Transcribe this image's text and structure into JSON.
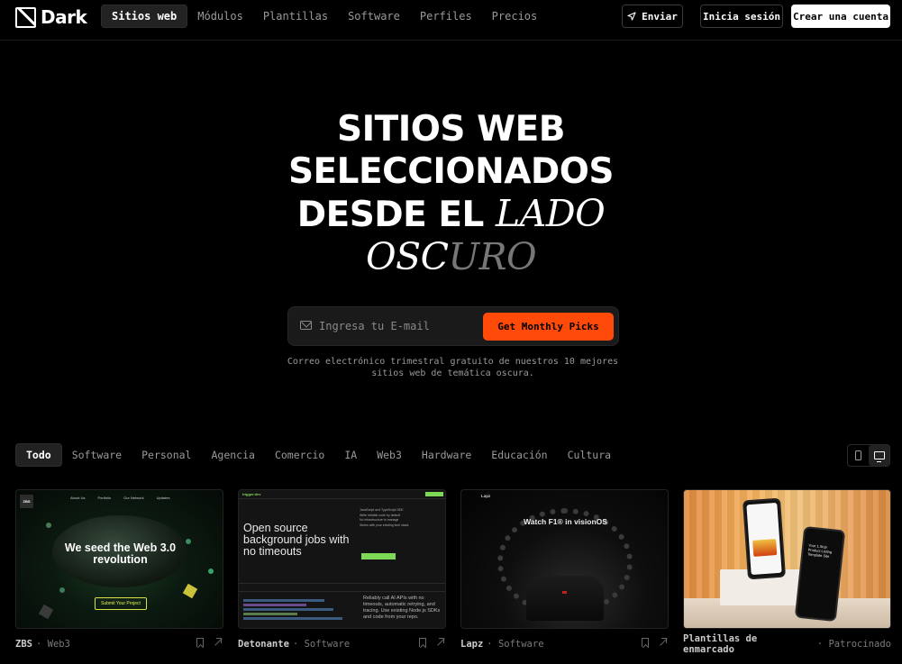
{
  "brand": {
    "name": "Dark"
  },
  "nav": {
    "links": [
      "Sitios web",
      "Módulos",
      "Plantillas",
      "Software",
      "Perfiles",
      "Precios"
    ],
    "submit_label": "Enviar",
    "login_label": "Inicia sesión",
    "signup_label": "Crear una cuenta"
  },
  "hero": {
    "line1": "SITIOS WEB",
    "line2": "SELECCIONADOS",
    "line3": "DESDE EL",
    "line3_serif": "LADO",
    "line4_a": "OSC",
    "line4_b": "URO",
    "email_placeholder": "Ingresa tu E-mail",
    "cta_label": "Get Monthly Picks",
    "note": "Correo electrónico trimestral gratuito de nuestros 10 mejores sitios web de temática oscura."
  },
  "filters": [
    "Todo",
    "Software",
    "Personal",
    "Agencia",
    "Comercio",
    "IA",
    "Web3",
    "Hardware",
    "Educación",
    "Cultura"
  ],
  "view_modes": [
    "mobile",
    "desktop"
  ],
  "cards": [
    {
      "name": "ZBS",
      "category": "Web3",
      "preview": {
        "badge": "ZBS",
        "nav": [
          "About Us",
          "Portfolio",
          "Our Network",
          "Updates"
        ],
        "headline_1": "We seed the Web 3.0",
        "headline_2": "revolution",
        "cta": "Submit Your Project"
      }
    },
    {
      "name": "Detonante",
      "category": "Software",
      "preview": {
        "logo": "trigger.dev",
        "headline": "Open source background jobs with no timeouts",
        "bullets": [
          "JavaScript and TypeScript SDK",
          "Write reliable code by default",
          "No infrastructure to manage",
          "Works with your existing tech stack"
        ],
        "description": "Reliably call AI APIs with no timeouts, automatic retrying, and tracing. Use existing Node.js SDKs and code from your repo."
      }
    },
    {
      "name": "Lapz",
      "category": "Software",
      "preview": {
        "logo": "Lapz",
        "title": "Watch F1® in visionOS"
      }
    },
    {
      "name": "Plantillas de enmarcado",
      "category": "Patrocinado",
      "preview": {
        "tagline": "Your 1,Stop Product Listing Template Site"
      }
    }
  ]
}
